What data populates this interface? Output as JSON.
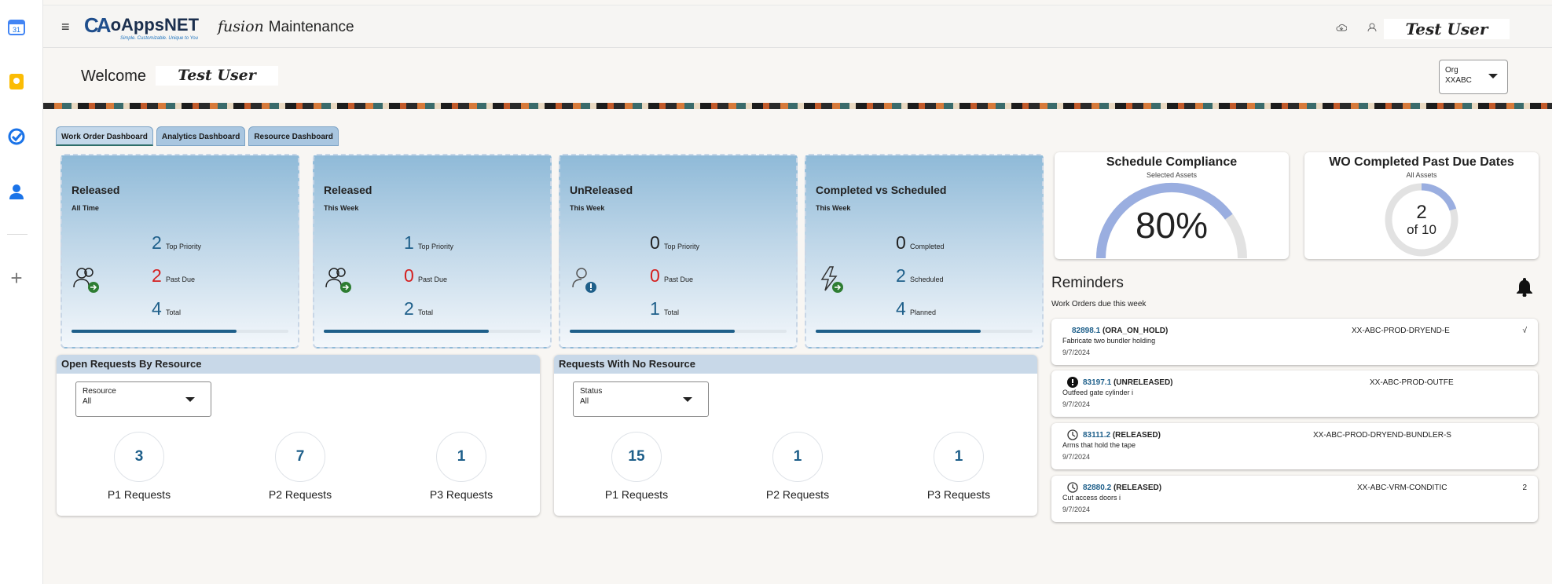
{
  "rail": {
    "calendar_badge": "31"
  },
  "header": {
    "logo_mark": "CA",
    "logo_text": "oAppsNET",
    "logo_tag": "Simple. Customizable. Unique to You",
    "app_fusion": "fusion",
    "app_title": "Maintenance",
    "user": "Test  User"
  },
  "welcome": {
    "label": "Welcome",
    "user": "Test User"
  },
  "org": {
    "label": "Org",
    "value": "XXABC"
  },
  "tabs": [
    "Work Order Dashboard",
    "Analytics Dashboard",
    "Resource Dashboard"
  ],
  "cards": [
    {
      "title": "Released",
      "subtitle": "All Time",
      "stats": [
        {
          "value": "2",
          "label": "Top Priority"
        },
        {
          "value": "2",
          "label": "Past Due"
        },
        {
          "value": "4",
          "label": "Total"
        }
      ],
      "progress": 0.76
    },
    {
      "title": "Released",
      "subtitle": "This Week",
      "stats": [
        {
          "value": "1",
          "label": "Top Priority"
        },
        {
          "value": "0",
          "label": "Past Due"
        },
        {
          "value": "2",
          "label": "Total"
        }
      ],
      "progress": 0.76
    },
    {
      "title": "UnReleased",
      "subtitle": "This Week",
      "stats": [
        {
          "value": "0",
          "label": "Top Priority"
        },
        {
          "value": "0",
          "label": "Past Due"
        },
        {
          "value": "1",
          "label": "Total"
        }
      ],
      "progress": 0.76
    },
    {
      "title": "Completed vs Scheduled",
      "subtitle": "This Week",
      "stats": [
        {
          "value": "0",
          "label": "Completed"
        },
        {
          "value": "2",
          "label": "Scheduled"
        },
        {
          "value": "4",
          "label": "Planned"
        }
      ],
      "progress": 0.76
    }
  ],
  "schedule": {
    "title": "Schedule Compliance",
    "subtitle": "Selected Assets",
    "value": "80%",
    "fraction": 0.8
  },
  "wo_past_due": {
    "title": "WO Completed Past Due Dates",
    "subtitle": "All Assets",
    "count": "2",
    "of": "of 10",
    "fraction": 0.2
  },
  "reminders": {
    "title": "Reminders",
    "subtitle": "Work Orders due this week",
    "items": [
      {
        "num": "82898.1",
        "status": "(ORA_ON_HOLD)",
        "desc": "Fabricate two bundler holding",
        "date": "9/7/2024",
        "asset": "XX-ABC-PROD-DRYEND-E",
        "extra": "√"
      },
      {
        "num": "83197.1",
        "status": "(UNRELEASED)",
        "desc": "Outfeed gate cylinder i",
        "date": "9/7/2024",
        "asset": "XX-ABC-PROD-OUTFE",
        "extra": ""
      },
      {
        "num": "83111.2",
        "status": "(RELEASED)",
        "desc": "Arms that hold the tape",
        "date": "9/7/2024",
        "asset": "XX-ABC-PROD-DRYEND-BUNDLER-S",
        "extra": ""
      },
      {
        "num": "82880.2",
        "status": "(RELEASED)",
        "desc": "Cut access doors i",
        "date": "9/7/2024",
        "asset": "XX-ABC-VRM-CONDITIC",
        "extra": "2"
      }
    ]
  },
  "open_by_resource": {
    "title": "Open Requests By Resource",
    "filter_label": "Resource",
    "filter_value": "All",
    "items": [
      {
        "count": "3",
        "label": "P1 Requests"
      },
      {
        "count": "7",
        "label": "P2 Requests"
      },
      {
        "count": "1",
        "label": "P3 Requests"
      }
    ]
  },
  "no_resource": {
    "title": "Requests With No Resource",
    "filter_label": "Status",
    "filter_value": "All",
    "items": [
      {
        "count": "15",
        "label": "P1 Requests"
      },
      {
        "count": "1",
        "label": "P2 Requests"
      },
      {
        "count": "1",
        "label": "P3 Requests"
      }
    ]
  }
}
